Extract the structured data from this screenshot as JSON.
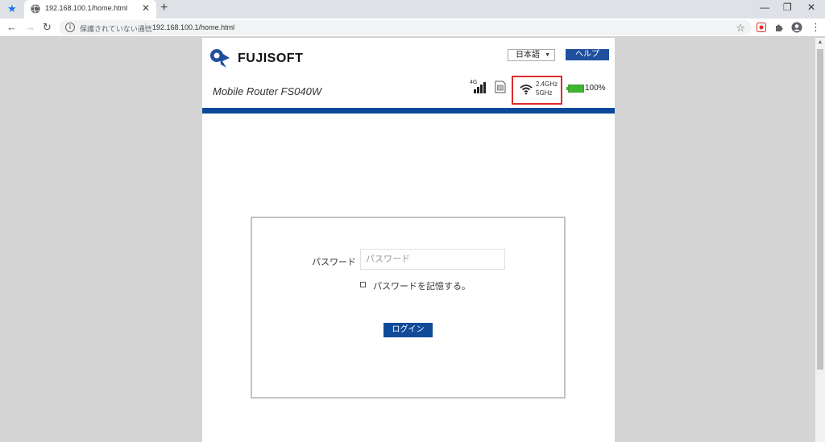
{
  "browser": {
    "tab_title": "192.168.100.1/home.html",
    "security_text": "保護されていない通信",
    "url": "192.168.100.1/home.html"
  },
  "header": {
    "brand": "FUJISOFT",
    "language_selected": "日本語",
    "help_label": "ヘルプ",
    "model": "Mobile Router FS040W"
  },
  "status": {
    "network_type": "4G",
    "wifi_band_1": "2.4GHz",
    "wifi_band_2": "5GHz",
    "battery_percent": "100%"
  },
  "login": {
    "password_label": "パスワード",
    "password_placeholder": "パスワード",
    "remember_label": "パスワードを記憶する。",
    "login_button": "ログイン"
  },
  "colors": {
    "brand_blue": "#0b4a99",
    "highlight_red": "#e0282a",
    "battery_green": "#3fb62e"
  }
}
